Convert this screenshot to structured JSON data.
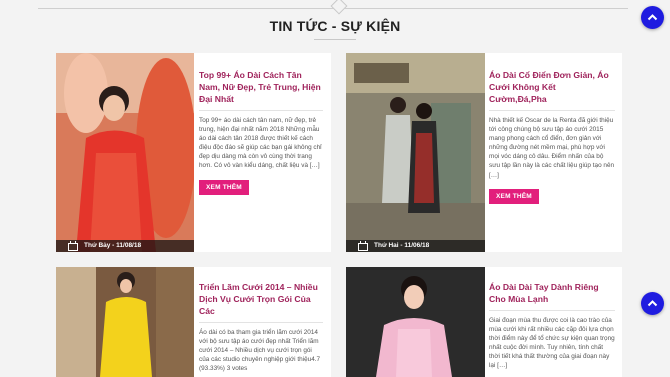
{
  "section": {
    "title": "TIN TỨC - SỰ KIỆN"
  },
  "cards": [
    {
      "title": "Top 99+ Áo Dài Cách Tân Nam, Nữ Đẹp, Trẻ Trung, Hiện Đại Nhất",
      "excerpt": "Top 99+ áo dài cách tân nam, nữ đẹp, trẻ trung, hiện đại nhất năm 2018 Những mẫu áo dài cách tân 2018 được thiết kế cách điệu độc đáo sẽ giúp các bạn gái không chỉ đẹp dịu dàng mà còn vô cùng thời trang hơn. Có vô vàn kiểu dáng, chất liệu và […]",
      "button": "XEM THÊM",
      "date": "Thứ Bảy - 11/08/18"
    },
    {
      "title": "Áo Dài Cổ Điển Đơn Giản, Áo Cưới Không Kết Cườm,Đá,Pha",
      "excerpt": "Nhà thiết kế Oscar de la Renta đã giới thiệu tới công chúng bộ sưu tập áo cưới 2015 mang phong cách cổ điển, đơn giản với những đường nét mềm mại, phù hợp với mọi vóc dáng cô dâu. Điểm nhấn của bộ sưu tập lần này là các chất liệu giúp tạo nên […]",
      "button": "XEM THÊM",
      "date": "Thứ Hai - 11/06/18"
    },
    {
      "title": "Triển Lãm Cưới 2014 – Nhiều Dịch Vụ Cưới Trọn Gói Của Các",
      "excerpt": "Áo dài có ba tham gia triển lãm cưới 2014 với bộ sưu tập áo cưới đẹp nhất Triển lãm cưới 2014 – Nhiều dịch vụ cưới trọn gói của các studio chuyên nghiệp giới thiệu4.7 (93.33%) 3 votes"
    },
    {
      "title": "Áo Dài Dài Tay Dành Riêng Cho Mùa Lạnh",
      "excerpt": "Giai đoạn mùa thu được coi là cao trào của mùa cưới khi rất nhiều các cặp đôi lựa chọn thời điểm này để tổ chức sự kiện quan trọng nhất cuộc đời mình. Tuy nhiên, tính chất thời tiết khá thất thường của giai đoạn này lại […]"
    }
  ],
  "colors": {
    "accent": "#e21f7c",
    "title": "#a0245c",
    "scroll": "#1f1ce0"
  }
}
